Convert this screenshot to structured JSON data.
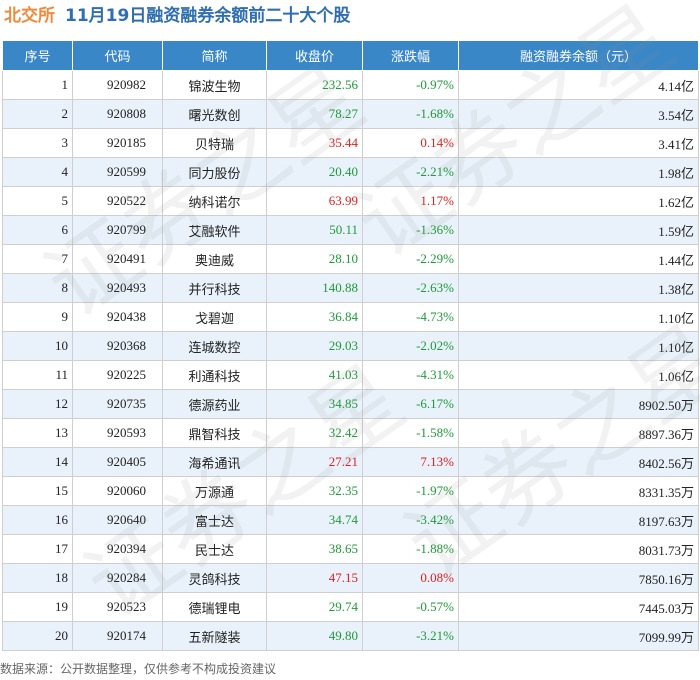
{
  "title": {
    "market": "北交所",
    "rest": "11月19日融资融券余额前二十大个股"
  },
  "columns": [
    "序号",
    "代码",
    "简称",
    "收盘价",
    "涨跌幅",
    "融资融券余额（元）"
  ],
  "rows": [
    {
      "idx": "1",
      "code": "920982",
      "name": "锦波生物",
      "price": "232.56",
      "change": "-0.97%",
      "balance": "4.14亿",
      "dir": "down"
    },
    {
      "idx": "2",
      "code": "920808",
      "name": "曙光数创",
      "price": "78.27",
      "change": "-1.68%",
      "balance": "3.54亿",
      "dir": "down"
    },
    {
      "idx": "3",
      "code": "920185",
      "name": "贝特瑞",
      "price": "35.44",
      "change": "0.14%",
      "balance": "3.41亿",
      "dir": "up"
    },
    {
      "idx": "4",
      "code": "920599",
      "name": "同力股份",
      "price": "20.40",
      "change": "-2.21%",
      "balance": "1.98亿",
      "dir": "down"
    },
    {
      "idx": "5",
      "code": "920522",
      "name": "纳科诺尔",
      "price": "63.99",
      "change": "1.17%",
      "balance": "1.62亿",
      "dir": "up"
    },
    {
      "idx": "6",
      "code": "920799",
      "name": "艾融软件",
      "price": "50.11",
      "change": "-1.36%",
      "balance": "1.59亿",
      "dir": "down"
    },
    {
      "idx": "7",
      "code": "920491",
      "name": "奥迪威",
      "price": "28.10",
      "change": "-2.29%",
      "balance": "1.44亿",
      "dir": "down"
    },
    {
      "idx": "8",
      "code": "920493",
      "name": "并行科技",
      "price": "140.88",
      "change": "-2.63%",
      "balance": "1.38亿",
      "dir": "down"
    },
    {
      "idx": "9",
      "code": "920438",
      "name": "戈碧迦",
      "price": "36.84",
      "change": "-4.73%",
      "balance": "1.10亿",
      "dir": "down"
    },
    {
      "idx": "10",
      "code": "920368",
      "name": "连城数控",
      "price": "29.03",
      "change": "-2.02%",
      "balance": "1.10亿",
      "dir": "down"
    },
    {
      "idx": "11",
      "code": "920225",
      "name": "利通科技",
      "price": "41.03",
      "change": "-4.31%",
      "balance": "1.06亿",
      "dir": "down"
    },
    {
      "idx": "12",
      "code": "920735",
      "name": "德源药业",
      "price": "34.85",
      "change": "-6.17%",
      "balance": "8902.50万",
      "dir": "down"
    },
    {
      "idx": "13",
      "code": "920593",
      "name": "鼎智科技",
      "price": "32.42",
      "change": "-1.58%",
      "balance": "8897.36万",
      "dir": "down"
    },
    {
      "idx": "14",
      "code": "920405",
      "name": "海希通讯",
      "price": "27.21",
      "change": "7.13%",
      "balance": "8402.56万",
      "dir": "up"
    },
    {
      "idx": "15",
      "code": "920060",
      "name": "万源通",
      "price": "32.35",
      "change": "-1.97%",
      "balance": "8331.35万",
      "dir": "down"
    },
    {
      "idx": "16",
      "code": "920640",
      "name": "富士达",
      "price": "34.74",
      "change": "-3.42%",
      "balance": "8197.63万",
      "dir": "down"
    },
    {
      "idx": "17",
      "code": "920394",
      "name": "民士达",
      "price": "38.65",
      "change": "-1.88%",
      "balance": "8031.73万",
      "dir": "down"
    },
    {
      "idx": "18",
      "code": "920284",
      "name": "灵鸽科技",
      "price": "47.15",
      "change": "0.08%",
      "balance": "7850.16万",
      "dir": "up"
    },
    {
      "idx": "19",
      "code": "920523",
      "name": "德瑞锂电",
      "price": "29.74",
      "change": "-0.57%",
      "balance": "7445.03万",
      "dir": "down"
    },
    {
      "idx": "20",
      "code": "920174",
      "name": "五新隧装",
      "price": "49.80",
      "change": "-3.21%",
      "balance": "7099.99万",
      "dir": "down"
    }
  ],
  "footer": "数据来源：公开数据整理，仅供参考不构成投资建议",
  "watermark": "证券之星",
  "colors": {
    "header_bg": "#3a87c8",
    "up": "#e02020",
    "down": "#1f9a3a",
    "market_title": "#f08a3c",
    "title": "#2f6fb0",
    "stripe": "#e9f2fb"
  }
}
